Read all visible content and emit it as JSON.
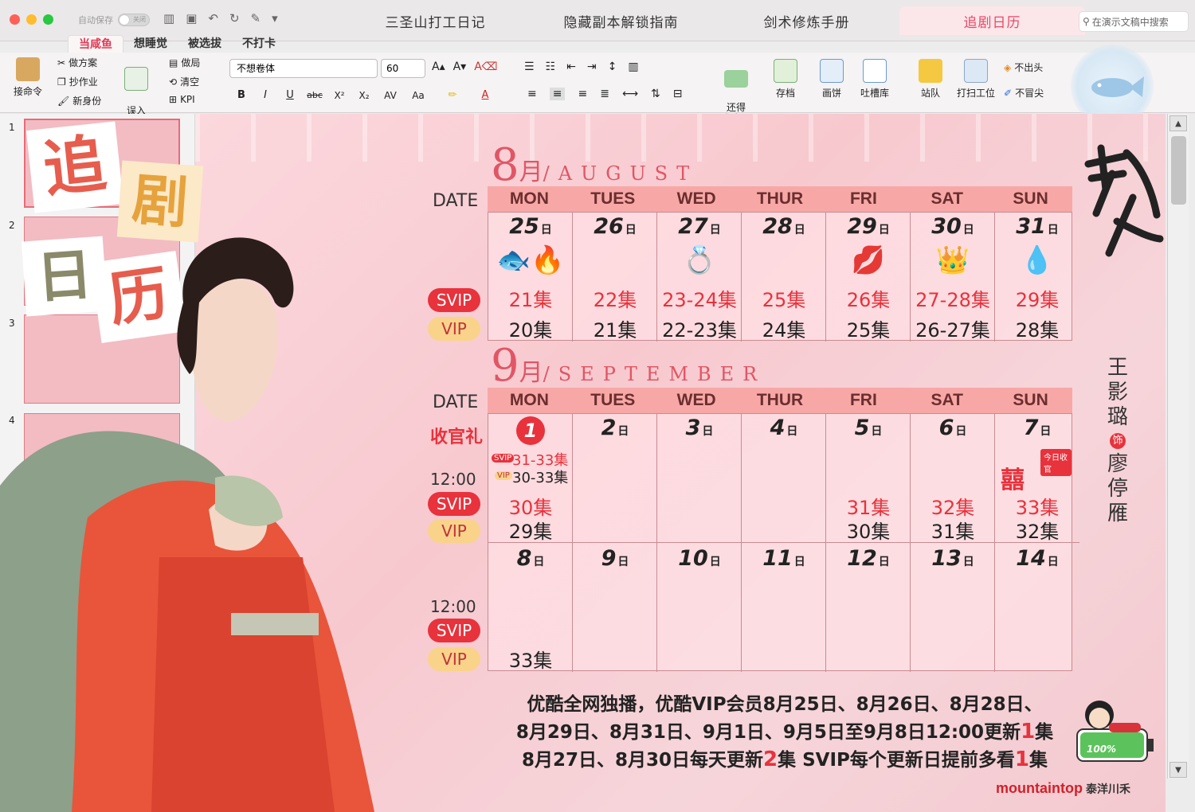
{
  "window": {
    "autosave_label": "自动保存",
    "autosave_state": "关闭",
    "doc_tabs": [
      "三圣山打工日记",
      "隐藏副本解锁指南",
      "剑术修炼手册",
      "追剧日历"
    ],
    "search_placeholder": "在演示文稿中搜索"
  },
  "ribbon_tabs": [
    "当咸鱼",
    "想睡觉",
    "被选拔",
    "不打卡"
  ],
  "ribbon": {
    "paste": "接命令",
    "cut": "做方案",
    "copy": "抄作业",
    "format_painter": "新身份",
    "new_slide": "误入\n修仙界",
    "layout": "做局",
    "reset": "清空",
    "kpi": "KPI",
    "font_name": "不想卷体",
    "font_size": "60",
    "convert": "还得\n当牛马",
    "save_pic": "存档",
    "draw": "画饼",
    "textbox": "吐槽库",
    "arrange": "站队",
    "quick_styles": "打扫工位",
    "shape_fill": "不出头",
    "shape_outline": "不冒尖"
  },
  "thumbnails": [
    "1",
    "2",
    "3",
    "4"
  ],
  "calendar": {
    "date_label": "DATE",
    "weekdays": [
      "MON",
      "TUES",
      "WED",
      "THUR",
      "FRI",
      "SAT",
      "SUN"
    ],
    "day_suffix": "日",
    "svip": "SVIP",
    "vip": "VIP",
    "august": {
      "num": "8",
      "zh": "月",
      "en": "/AUGUST",
      "days": [
        "25",
        "26",
        "27",
        "28",
        "29",
        "30",
        "31"
      ],
      "svip_eps": [
        "21集",
        "22集",
        "23-24集",
        "25集",
        "26集",
        "27-28集",
        "29集"
      ],
      "vip_eps": [
        "20集",
        "21集",
        "22-23集",
        "24集",
        "25集",
        "26-27集",
        "28集"
      ]
    },
    "september": {
      "num": "9",
      "zh": "月",
      "en": "/SEPTEMBER",
      "gift_label": "收官礼",
      "time": "12:00",
      "gift_svip": "31-33集",
      "gift_vip": "30-33集",
      "gift_svip_tag": "SVIP",
      "gift_vip_tag": "VIP",
      "week1_days": [
        "1",
        "2",
        "3",
        "4",
        "5",
        "6",
        "7"
      ],
      "week1_svip": [
        "30集",
        "",
        "",
        "",
        "31集",
        "32集",
        "33集"
      ],
      "week1_vip": [
        "29集",
        "",
        "",
        "",
        "30集",
        "31集",
        "32集"
      ],
      "week2_days": [
        "8",
        "9",
        "10",
        "11",
        "12",
        "13",
        "14"
      ],
      "week2_vip_first": "33集",
      "finale_tag": "今日收官",
      "finale_char": "囍"
    }
  },
  "notes": {
    "line1": "优酷全网独播，优酷VIP会员8月25日、8月26日、8月28日、",
    "line2a": "8月29日、8月31日、9月1日、9月5日至9月8日12:00更新",
    "line2n": "1",
    "line2b": "集",
    "line3a": "8月27日、8月30日每天更新",
    "line3n": "2",
    "line3b": "集   SVIP每个更新日提前多看",
    "line3n2": "1",
    "line3c": "集"
  },
  "cast": "王影璐饰廖停雁",
  "cast_role_mark": "饰",
  "calendar_title_chars": [
    "追",
    "剧",
    "日",
    "历"
  ],
  "battery": "100%",
  "logo": "mountaintop",
  "logo_sub": "泰洋川禾",
  "colors": {
    "accent": "#e8323c",
    "tab_active": "#e84a66",
    "header_row": "#f7a8a6"
  }
}
